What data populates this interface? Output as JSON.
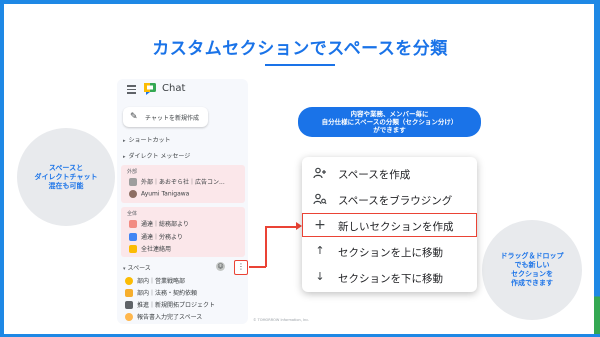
{
  "title": "カスタムセクションでスペースを分類",
  "left_note": "スペースと\nダイレクトチャット\n混在も可能",
  "right_note": "ドラッグ＆ドロップ\nでも新しい\nセクションを\n作成できます",
  "bubble": "内容や業務、メンバー毎に\n自分仕様にスペースの分類（セクション分け）\nができます",
  "copyright": "© TOMORROW Information, Inc.",
  "chat": {
    "app_name": "Chat",
    "new_chat_label": "チャットを新規作成",
    "shortcuts_label": "ショートカット",
    "dm_label": "ダイレクト メッセージ",
    "sections": [
      {
        "label": "外部",
        "items": [
          {
            "text": "外部｜あおぞら社｜広告コン...",
            "color": "#9e9e9e"
          },
          {
            "text": "Ayumi Tanigawa",
            "color": "#8d6e63"
          }
        ]
      },
      {
        "label": "全体",
        "items": [
          {
            "text": "通達｜総務部より",
            "color": "#f28b82"
          },
          {
            "text": "通達｜労務より",
            "color": "#4285f4"
          },
          {
            "text": "全社連絡用",
            "color": "#fbbc04"
          }
        ]
      }
    ],
    "spaces_label": "スペース",
    "space_items": [
      {
        "text": "部内｜営業戦略部",
        "color": "#fbbc04"
      },
      {
        "text": "部内｜法務・契約依頼",
        "color": "#f6ae2d"
      },
      {
        "text": "推進｜新規開拓プロジェクト",
        "color": "#5f6368"
      },
      {
        "text": "報告書入力完了スペース",
        "color": "#ffb74d"
      }
    ]
  },
  "menu": {
    "items": [
      {
        "icon": "person-add-icon",
        "glyph": "👥",
        "label": "スペースを作成"
      },
      {
        "icon": "browse-spaces-icon",
        "glyph": "🔍",
        "label": "スペースをブラウジング"
      },
      {
        "icon": "plus-icon",
        "glyph": "+",
        "label": "新しいセクションを作成"
      },
      {
        "icon": "arrow-up-icon",
        "glyph": "↑",
        "label": "セクションを上に移動"
      },
      {
        "icon": "arrow-down-icon",
        "glyph": "↓",
        "label": "セクションを下に移動"
      }
    ]
  },
  "colors": {
    "accent": "#1a73e8",
    "highlight": "#ea4335"
  }
}
